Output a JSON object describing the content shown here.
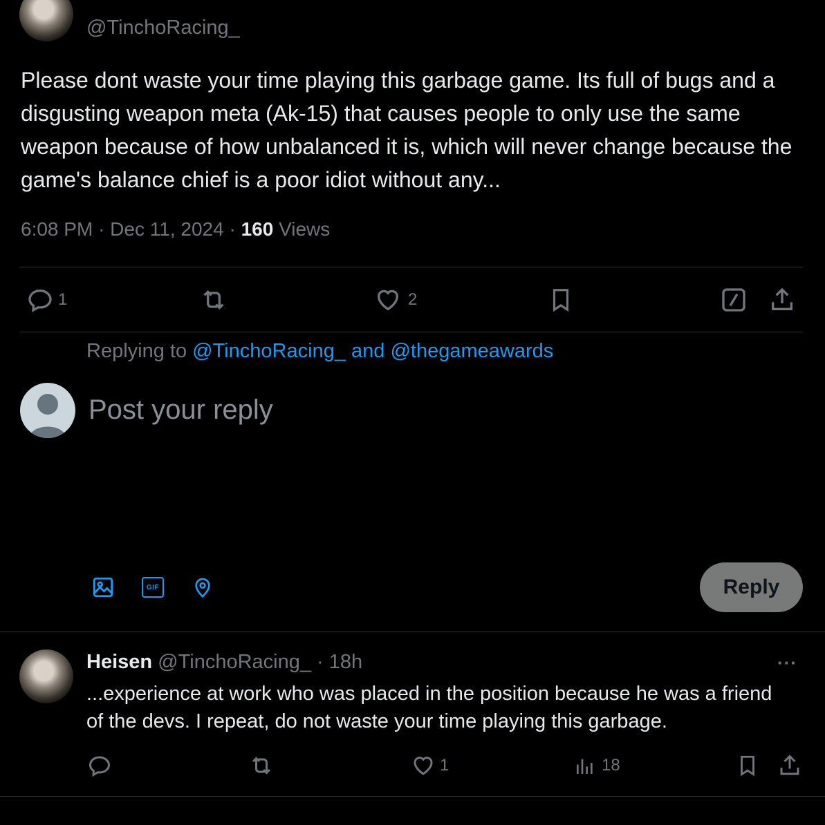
{
  "tweet": {
    "handle": "@TinchoRacing_",
    "text": "Please dont waste your time playing this garbage game. Its full of bugs and a disgusting weapon meta (Ak-15) that causes people to only use the same weapon because of how unbalanced it is, which will never change because the game's balance chief is a poor idiot without any...",
    "time": "6:08 PM",
    "date": "Dec 11, 2024",
    "views_count": "160",
    "views_label": "Views",
    "sep": "·",
    "reply_count": "1",
    "like_count": "2"
  },
  "composer": {
    "replying_prefix": "Replying to",
    "replying_users": "@TinchoRacing_ and @thegameawards",
    "placeholder": "Post your reply",
    "reply_button": "Reply",
    "gif_label": "GIF"
  },
  "reply": {
    "name": "Heisen",
    "handle": "@TinchoRacing_",
    "age": "· 18h",
    "text": "...experience at work who was placed in the position because he was a friend of the devs. I repeat, do not waste your time playing this garbage.",
    "like_count": "1",
    "views_count": "18",
    "more": "···"
  },
  "colors": {
    "background": "#000000",
    "text": "#e7e9ea",
    "muted": "#71767b",
    "accent": "#1d9bf0",
    "divider": "#2f3336",
    "reply_button_bg": "#787a7a"
  }
}
